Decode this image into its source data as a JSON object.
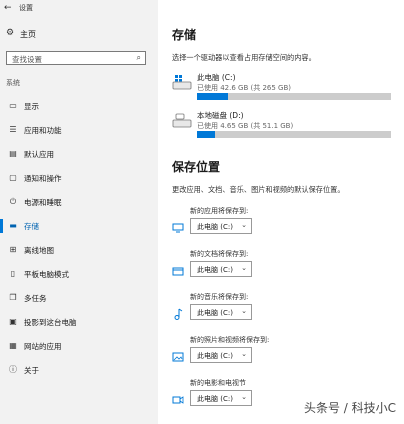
{
  "titlebar": {
    "back_icon": "back-arrow-icon",
    "title": "设置"
  },
  "home": {
    "label": "主页",
    "icon": "gear-icon"
  },
  "search": {
    "placeholder": "查找设置",
    "icon": "search-icon"
  },
  "sidebar": {
    "section_label": "系统",
    "items": [
      {
        "label": "显示",
        "icon": "display-icon"
      },
      {
        "label": "应用和功能",
        "icon": "apps-icon"
      },
      {
        "label": "默认应用",
        "icon": "default-apps-icon"
      },
      {
        "label": "通知和操作",
        "icon": "notifications-icon"
      },
      {
        "label": "电源和睡眠",
        "icon": "power-icon"
      },
      {
        "label": "存储",
        "icon": "storage-icon",
        "active": true
      },
      {
        "label": "离线地图",
        "icon": "map-icon"
      },
      {
        "label": "平板电脑模式",
        "icon": "tablet-icon"
      },
      {
        "label": "多任务",
        "icon": "multitask-icon"
      },
      {
        "label": "投影到这台电脑",
        "icon": "project-icon"
      },
      {
        "label": "网站的应用",
        "icon": "web-apps-icon"
      },
      {
        "label": "关于",
        "icon": "info-icon"
      }
    ]
  },
  "storage": {
    "title": "存储",
    "subtitle": "选择一个驱动器以查看占用存储空间的内容。",
    "drives": [
      {
        "name": "此电脑 (C:)",
        "usage": "已使用 42.6 GB (共 265 GB)",
        "fraction": 0.161
      },
      {
        "name": "本地磁盘 (D:)",
        "usage": "已使用 4.65 GB (共 51.1 GB)",
        "fraction": 0.091
      }
    ]
  },
  "save_locations": {
    "title": "保存位置",
    "subtitle": "更改应用、文档、音乐、图片和视频的默认保存位置。",
    "items": [
      {
        "caption": "新的应用将保存到:",
        "value": "此电脑 (C:)",
        "icon": "monitor-icon"
      },
      {
        "caption": "新的文档将保存到:",
        "value": "此电脑 (C:)",
        "icon": "folder-icon"
      },
      {
        "caption": "新的音乐将保存到:",
        "value": "此电脑 (C:)",
        "icon": "music-note-icon"
      },
      {
        "caption": "新的照片和视频将保存到:",
        "value": "此电脑 (C:)",
        "icon": "photo-icon"
      },
      {
        "caption": "新的电影和电视节",
        "value": "此电脑 (C:)",
        "icon": "video-camera-icon"
      }
    ]
  },
  "watermark": "头条号 / 科技小C",
  "colors": {
    "accent": "#0078d7",
    "sidebar_bg": "#f2f2f2",
    "bar_track": "#cccccc"
  }
}
